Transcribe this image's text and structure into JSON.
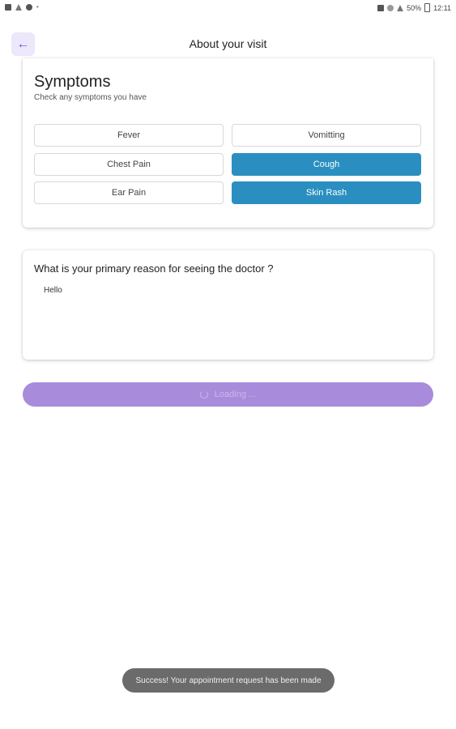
{
  "status_bar": {
    "battery": "50%",
    "time": "12:11",
    "left_icons": [
      "gallery-icon",
      "telegram-icon",
      "bag-icon",
      "dot-icon"
    ],
    "right_icons": [
      "nfc-icon",
      "wifi-icon",
      "signal-icon",
      "battery-icon"
    ]
  },
  "header": {
    "title": "About your visit",
    "back_icon": "arrow-left-icon",
    "accent": "#6a4fd0"
  },
  "symptoms": {
    "title": "Symptoms",
    "subtitle": "Check any symptoms you have",
    "selected_color": "#2a8fc0",
    "options": [
      {
        "label": "Fever",
        "selected": false
      },
      {
        "label": "Vomitting",
        "selected": false
      },
      {
        "label": "Chest Pain",
        "selected": false
      },
      {
        "label": "Cough",
        "selected": true
      },
      {
        "label": "Ear Pain",
        "selected": false
      },
      {
        "label": "Skin Rash",
        "selected": true
      }
    ]
  },
  "reason": {
    "question": "What is your primary reason for seeing the doctor ?",
    "value": "Hello"
  },
  "submit": {
    "label": "Loading ...",
    "color": "#a98bdc"
  },
  "toast": {
    "message": "Success! Your appointment request has been made"
  }
}
